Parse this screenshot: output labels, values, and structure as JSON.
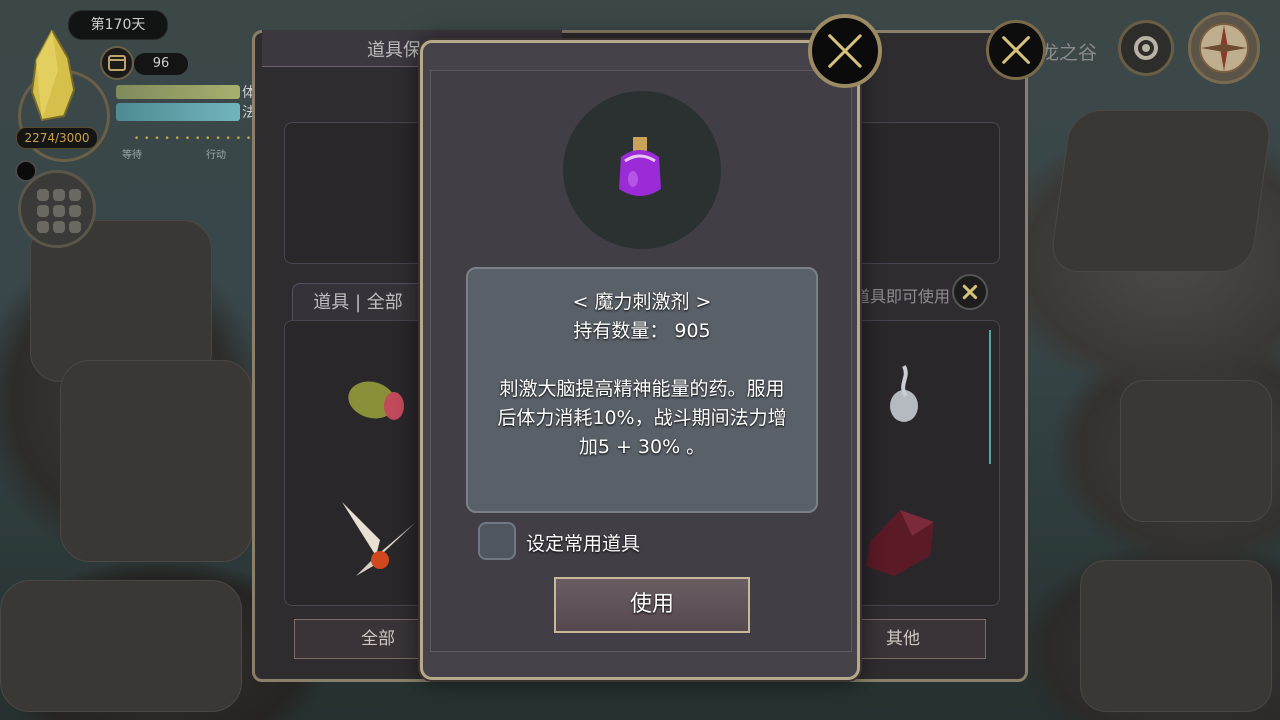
{
  "hud": {
    "day_label": "第170天",
    "stamina_value": "96",
    "xp_value": "2274/3000",
    "hp_label": "体",
    "mp_label": "法",
    "wait_label": "等待",
    "action_label": "行动",
    "action_dots": "• • • • • • • • • • • • • •"
  },
  "location": {
    "name": "龙之谷"
  },
  "storage": {
    "title": "道具保管箱",
    "items_tab": "道具 | 全部",
    "hint": "点击道具即可使用",
    "categories": [
      "全部",
      "其他"
    ]
  },
  "detail": {
    "item_name": "< 魔力刺激剂 >",
    "quantity_line": "持有数量： 905",
    "description_lines": [
      "刺激大脑提高精神能量的药。服用",
      "后体力消耗10%，战斗期间法力增",
      "加5 + 30% 。"
    ],
    "favorite_label": "设定常用道具",
    "use_label": "使用"
  },
  "icons": {
    "close": "close-x-icon",
    "gear": "gear-icon",
    "compass": "compass-icon",
    "calendar": "calendar-icon",
    "menu": "grid-menu-icon",
    "potion": "purple-potion-icon"
  },
  "colors": {
    "accent_gold": "#b6a88a",
    "potion_purple": "#9b2bd6",
    "mp_bar": "#73b5bd",
    "hp_bar": "#a7b06d"
  }
}
